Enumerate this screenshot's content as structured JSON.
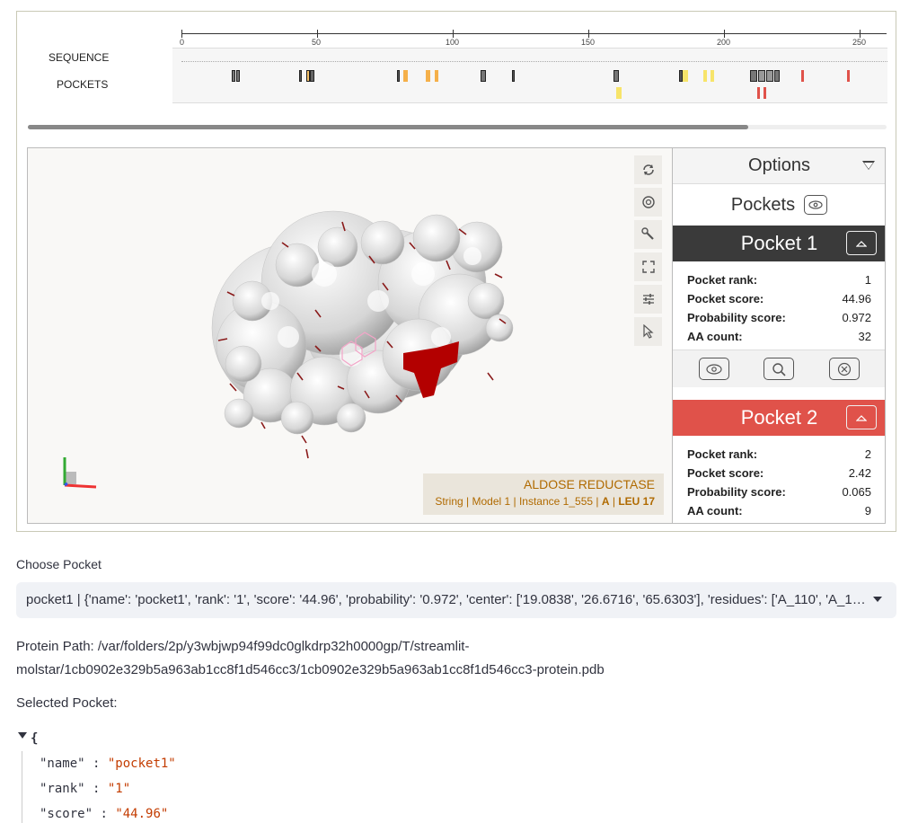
{
  "sequence_viewer": {
    "sequence_label": "SEQUENCE",
    "pockets_label": "POCKETS",
    "ruler_ticks": [
      "0",
      "50",
      "100",
      "150",
      "200",
      "250"
    ]
  },
  "viewer": {
    "tools": [
      {
        "icon": "reset-camera-icon"
      },
      {
        "icon": "screenshot-icon"
      },
      {
        "icon": "wrench-icon"
      },
      {
        "icon": "fullscreen-icon"
      },
      {
        "icon": "settings-sliders-icon"
      },
      {
        "icon": "select-cursor-icon"
      }
    ],
    "info": {
      "title": "ALDOSE REDUCTASE",
      "parts": [
        "String",
        "Model 1",
        "Instance 1_555"
      ],
      "chain": "A",
      "residue": "LEU 17"
    }
  },
  "options_panel": {
    "title": "Options",
    "pockets_heading": "Pockets",
    "pockets": [
      {
        "title": "Pocket 1",
        "color": "#3a3a3a",
        "rows": [
          {
            "key": "Pocket rank:",
            "value": "1"
          },
          {
            "key": "Pocket score:",
            "value": "44.96"
          },
          {
            "key": "Probability score:",
            "value": "0.972"
          },
          {
            "key": "AA count:",
            "value": "32"
          }
        ]
      },
      {
        "title": "Pocket 2",
        "color": "#e0524a",
        "rows": [
          {
            "key": "Pocket rank:",
            "value": "2"
          },
          {
            "key": "Pocket score:",
            "value": "2.42"
          },
          {
            "key": "Probability score:",
            "value": "0.065"
          },
          {
            "key": "AA count:",
            "value": "9"
          }
        ]
      }
    ]
  },
  "choose_pocket": {
    "label": "Choose Pocket",
    "selected": "pocket1 | {'name': 'pocket1', 'rank': '1', 'score': '44.96', 'probability': '0.972', 'center': ['19.0838', '26.6716', '65.6303'], 'residues': ['A_110', 'A_1…"
  },
  "protein_path": "Protein Path: /var/folders/2p/y3wbjwp94f99dc0glkdrp32h0000gp/T/streamlit-molstar/1cb0902e329b5a963ab1cc8f1d546cc3/1cb0902e329b5a963ab1cc8f1d546cc3-protein.pdb",
  "selected_pocket": {
    "label": "Selected Pocket:",
    "open_brace": "{",
    "entries": [
      {
        "key": "\"name\"",
        "value": "\"pocket1\""
      },
      {
        "key": "\"rank\"",
        "value": "\"1\""
      },
      {
        "key": "\"score\"",
        "value": "\"44.96\""
      }
    ]
  },
  "colors": {
    "pocket1": "#3a3a3a",
    "pocket2": "#e0524a",
    "highlight_red": "#b00000",
    "info_text": "#b06a00"
  }
}
